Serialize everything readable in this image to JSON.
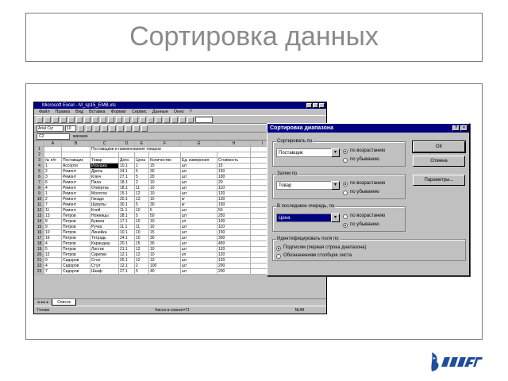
{
  "slide": {
    "title": "Сортировка данных"
  },
  "excel": {
    "title": "Microsoft Excel - M_sp15_EMB.xls",
    "menu": [
      "Файл",
      "Правка",
      "Вид",
      "Вставка",
      "Формат",
      "Сервис",
      "Данные",
      "Окно",
      "?"
    ],
    "name_box": "A3",
    "font_box": "Arial Cyr",
    "size_box": "10",
    "cell_ref": "C2",
    "formula_value": "магазин",
    "columns": [
      "A",
      "B",
      "C",
      "D",
      "E",
      "F",
      "G",
      "H",
      "I"
    ],
    "sheet_title": "Поставщики и наименования товаров",
    "headers": [
      "№ п/п",
      "Поставщик",
      "Товар",
      "Дата",
      "Цена",
      "Количество",
      "Ед. измерения",
      "Стоимость"
    ],
    "rows": [
      [
        "1",
        "Ассорти",
        "Игрушка",
        "10.1",
        "1",
        "15",
        "шт",
        "15"
      ],
      [
        "2",
        "Ремонт",
        "Дрель",
        "24.1",
        "5",
        "30",
        "шт",
        "150"
      ],
      [
        "3",
        "Ремонт",
        "Ключ",
        "27.1",
        "5",
        "20",
        "шт",
        "100"
      ],
      [
        "6",
        "Ремонт",
        "Пила",
        "18.1",
        "2",
        "10",
        "шт",
        "20"
      ],
      [
        "4",
        "Ремонт",
        "Отвёртка",
        "18.1",
        "11",
        "10",
        "шт",
        "110"
      ],
      [
        "1",
        "Ремонт",
        "Молоток",
        "15.1",
        "12",
        "10",
        "шт",
        "120"
      ],
      [
        "2",
        "Ремонт",
        "Гвозди",
        "20.1",
        "13",
        "10",
        "кг",
        "130"
      ],
      [
        "7",
        "Ремонт",
        "Шурупы",
        "30.1",
        "5",
        "30",
        "кг",
        "150"
      ],
      [
        "11",
        "Ремонт",
        "Клей",
        "11.1",
        "10",
        "5",
        "шт",
        "50"
      ],
      [
        "13",
        "Петров",
        "Ножницы",
        "28.1",
        "5",
        "50",
        "шт",
        "250"
      ],
      [
        "8",
        "Петров",
        "Бумага",
        "17.1",
        "10",
        "10",
        "уп",
        "100"
      ],
      [
        "9",
        "Петров",
        "Ручка",
        "11.1",
        "11",
        "10",
        "шт",
        "110"
      ],
      [
        "10",
        "Петров",
        "Линейка",
        "10.1",
        "10",
        "15",
        "шт",
        "150"
      ],
      [
        "16",
        "Петров",
        "Тетрадь",
        "24.1",
        "10",
        "30",
        "шт",
        "300"
      ],
      [
        "4",
        "Петров",
        "Карандаш",
        "20.1",
        "15",
        "30",
        "шт",
        "450"
      ],
      [
        "5",
        "Петров",
        "Ластик",
        "21.1",
        "12",
        "10",
        "шт",
        "120"
      ],
      [
        "12",
        "Петров",
        "Скрепки",
        "12.1",
        "12",
        "10",
        "уп",
        "120"
      ],
      [
        "9",
        "Сидоров",
        "Стол",
        "25.1",
        "12",
        "10",
        "шт",
        "120"
      ],
      [
        "4",
        "Сидоров",
        "Стул",
        "12.1",
        "2",
        "100",
        "шт",
        "200"
      ],
      [
        "7",
        "Сидоров",
        "Шкаф",
        "27.1",
        "5",
        "40",
        "шт",
        "200"
      ]
    ],
    "sheet_tab": "Список",
    "status_left": "Готово",
    "status_mid": "Число в списке=71",
    "status_right": "NUM"
  },
  "dialog": {
    "title": "Сортировка диапазона",
    "group1_label": "Сортировать по",
    "group1_value": "Поставщик",
    "group2_label": "Затем по",
    "group2_value": "Товар",
    "group3_label": "В последнюю очередь, по",
    "group3_value": "Цена",
    "asc_label": "по возрастанию",
    "desc_label": "по убыванию",
    "group4_label": "Идентифицировать поля по",
    "header_option": "Подписям (первая строка диапазона)",
    "nolabel_option": "Обозначениям столбцов листа",
    "ok_button": "ОК",
    "cancel_button": "Отмена",
    "params_button": "Параметры..."
  }
}
